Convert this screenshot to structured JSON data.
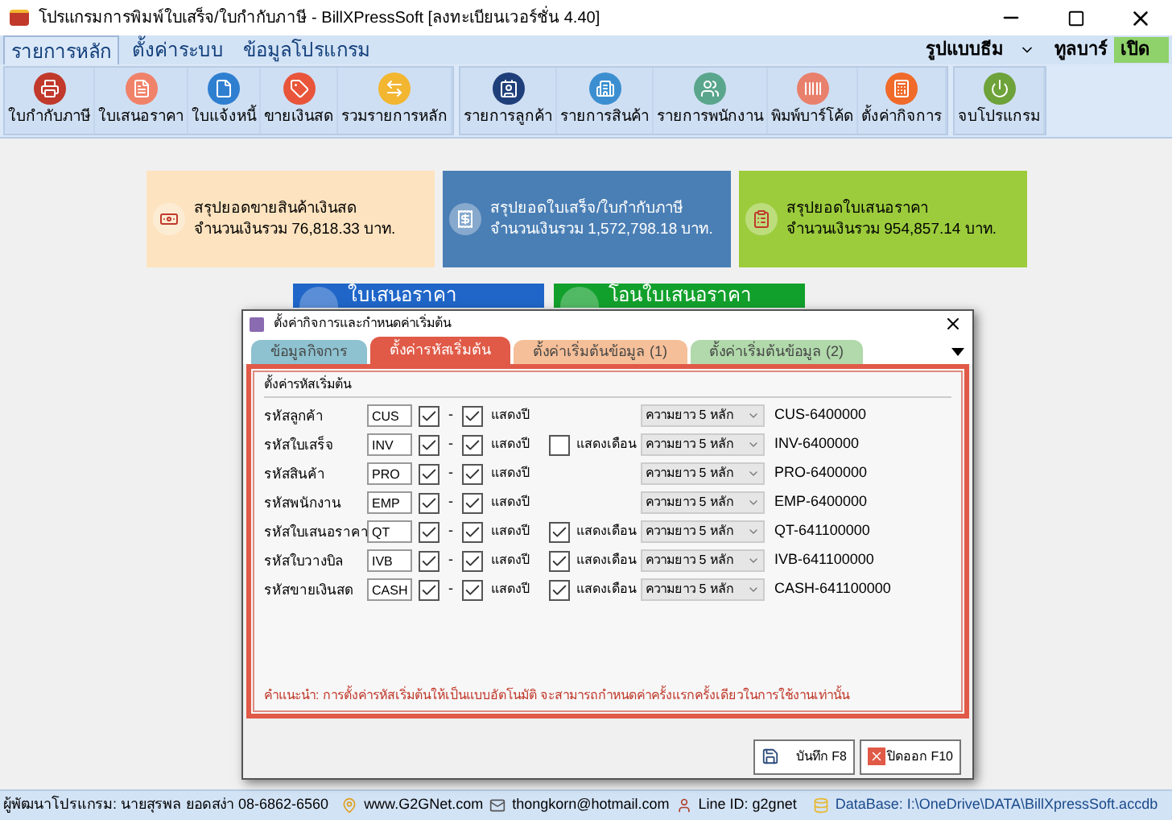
{
  "window": {
    "title": "โปรแกรมการพิมพ์ใบเสร็จ/ใบกำกับภาษี - BillXPressSoft [ลงทะเบียนเวอร์ชั่น 4.40]"
  },
  "menu_tabs": [
    {
      "label": "รายการหลัก",
      "selected": true
    },
    {
      "label": "ตั้งค่าระบบ",
      "selected": false
    },
    {
      "label": "ข้อมูลโปรแกรม",
      "selected": false
    }
  ],
  "theme_menu": {
    "label": "รูปแบบธีม"
  },
  "toolbar_toggle": {
    "label": "ทูลบาร์",
    "value": "เปิด",
    "on": true
  },
  "toolbar_groups": [
    {
      "buttons": [
        {
          "label": "ใบกำกับภาษี",
          "color": "#c0392b"
        },
        {
          "label": "ใบเสนอราคา",
          "color": "#f0826a"
        },
        {
          "label": "ใบแจ้งหนี้",
          "color": "#2f7fd1"
        },
        {
          "label": "ขายเงินสด",
          "color": "#e8553a"
        },
        {
          "label": "รวมรายการหลัก",
          "color": "#f2b630"
        }
      ]
    },
    {
      "buttons": [
        {
          "label": "รายการลูกค้า",
          "color": "#1f3f7a"
        },
        {
          "label": "รายการสินค้า",
          "color": "#3b8fd0"
        },
        {
          "label": "รายการพนักงาน",
          "color": "#5aa68c"
        },
        {
          "label": "พิมพ์บาร์โค้ด",
          "color": "#e8806c"
        },
        {
          "label": "ตั้งค่ากิจการ",
          "color": "#f06a2a"
        }
      ]
    },
    {
      "buttons": [
        {
          "label": "จบโปรแกรม",
          "color": "#6ea23a"
        }
      ]
    }
  ],
  "summary_cards": [
    {
      "title": "สรุปยอดขายสินค้าเงินสด",
      "amount": "จำนวนเงินรวม 76,818.33 บาท.",
      "color": "#fde3bf"
    },
    {
      "title": "สรุปยอดใบเสร็จ/ใบกำกับภาษี",
      "amount": "จำนวนเงินรวม 1,572,798.18 บาท.",
      "color": "#4a7fb5"
    },
    {
      "title": "สรุปยอดใบเสนอราคา",
      "amount": "จำนวนเงินรวม 954,857.14 บาท.",
      "color": "#9ccc3c"
    }
  ],
  "shortcut_cards": [
    {
      "label": "ใบเสนอราคา",
      "color": "#1f66c8"
    },
    {
      "label": "โอนใบเสนอราคา",
      "color": "#12a02c"
    }
  ],
  "dialog": {
    "title": "ตั้งค่ากิจการและกำหนดค่าเริ่มต้น",
    "tabs": [
      {
        "label": "ข้อมูลกิจการ",
        "selected": false,
        "color": "#82bccb"
      },
      {
        "label": "ตั้งค่ารหัสเริ่มต้น",
        "selected": true,
        "color": "#e05a47"
      },
      {
        "label": "ตั้งค่าเริ่มต้นข้อมูล (1)",
        "selected": false,
        "color": "#f4b98e"
      },
      {
        "label": "ตั้งค่าเริ่มต้นข้อมูล (2)",
        "selected": false,
        "color": "#a9d5a3"
      }
    ],
    "group_label": "ตั้งค่ารหัสเริ่มต้น",
    "rows": [
      {
        "label": "รหัสลูกค้า",
        "prefix": "CUS",
        "prefix_checked": true,
        "separator": "-",
        "year_checked": true,
        "year_label": "แสดงปี",
        "length": "ความยาว 5 หลัก",
        "preview": "CUS-6400000"
      },
      {
        "label": "รหัสใบเสร็จ",
        "prefix": "INV",
        "prefix_checked": true,
        "separator": "-",
        "year_checked": true,
        "year_label": "แสดงปี",
        "month": {
          "label": "แสดงเดือน",
          "checked": false
        },
        "length": "ความยาว 5 หลัก",
        "preview": "INV-6400000"
      },
      {
        "label": "รหัสสินค้า",
        "prefix": "PRO",
        "prefix_checked": true,
        "separator": "-",
        "year_checked": true,
        "year_label": "แสดงปี",
        "length": "ความยาว 5 หลัก",
        "preview": "PRO-6400000"
      },
      {
        "label": "รหัสพนักงาน",
        "prefix": "EMP",
        "prefix_checked": true,
        "separator": "-",
        "year_checked": true,
        "year_label": "แสดงปี",
        "length": "ความยาว 5 หลัก",
        "preview": "EMP-6400000"
      },
      {
        "label": "รหัสใบเสนอราคา",
        "prefix": "QT",
        "prefix_checked": true,
        "separator": "-",
        "year_checked": true,
        "year_label": "แสดงปี",
        "month": {
          "label": "แสดงเดือน",
          "checked": true
        },
        "length": "ความยาว 5 หลัก",
        "preview": "QT-641100000"
      },
      {
        "label": "รหัสใบวางบิล",
        "prefix": "IVB",
        "prefix_checked": true,
        "separator": "-",
        "year_checked": true,
        "year_label": "แสดงปี",
        "month": {
          "label": "แสดงเดือน",
          "checked": true
        },
        "length": "ความยาว 5 หลัก",
        "preview": "IVB-641100000"
      },
      {
        "label": "รหัสขายเงินสด",
        "prefix": "CASH",
        "prefix_checked": true,
        "separator": "-",
        "year_checked": true,
        "year_label": "แสดงปี",
        "month": {
          "label": "แสดงเดือน",
          "checked": true
        },
        "length": "ความยาว 5 หลัก",
        "preview": "CASH-641100000"
      }
    ],
    "hint": "คำแนะนำ: การตั้งค่ารหัสเริ่มต้นให้เป็นแบบอัตโนมัติ จะสามารถกำหนดค่าครั้งแรกครั้งเดียวในการใช้งานเท่านั้น",
    "buttons": [
      {
        "label": "บันทึก F8",
        "kind": "save"
      },
      {
        "label": "ปิดออก F10",
        "kind": "close"
      }
    ]
  },
  "status_bar": {
    "developer": "ผู้พัฒนาโปรแกรม: นายสุรพล ยอดสง่า 08-6862-6560",
    "website": "www.G2GNet.com",
    "email": "thongkorn@hotmail.com",
    "line_id": "Line ID: g2gnet",
    "database": "DataBase: I:\\OneDrive\\DATA\\BillXpressSoft.accdb"
  }
}
